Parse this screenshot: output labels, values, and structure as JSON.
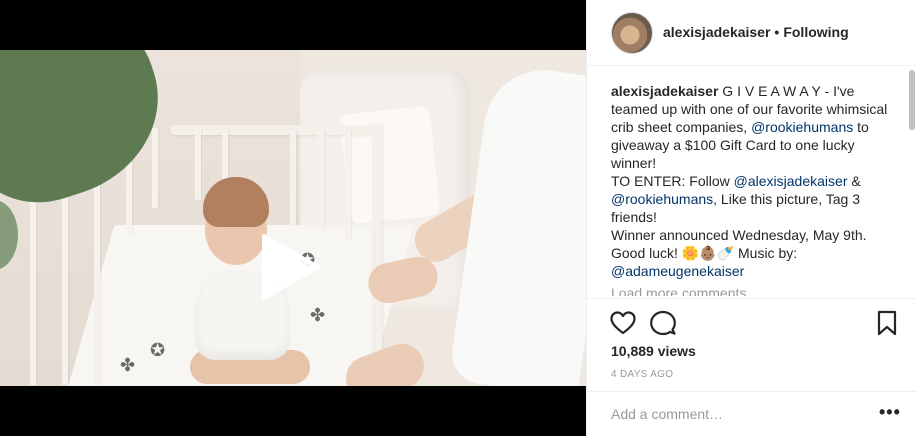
{
  "post": {
    "username": "alexisjadekaiser",
    "separator": "•",
    "follow_label": "Following"
  },
  "caption": {
    "user": "alexisjadekaiser",
    "text_1": " G I V E A W A Y - I've teamed up with one of our favorite whimsical crib sheet companies, ",
    "mention_1": "@rookiehumans",
    "text_2": " to giveaway a $100 Gift Card to one lucky winner!",
    "enter_line": "TO ENTER: Follow ",
    "mention_2": "@alexisjadekaiser",
    "text_3": " & ",
    "mention_3": "@rookiehumans",
    "text_4": ", Like this picture, Tag 3 friends!",
    "winner_line": "Winner announced Wednesday, May 9th.",
    "good_luck": "Good luck! 🌼👶🏽🍼 Music by:",
    "mention_4": "@adameugenekaiser"
  },
  "load_more": "Load more comments",
  "views": "10,889 views",
  "timestamp": "4 DAYS AGO",
  "comment_box": {
    "placeholder": "Add a comment…",
    "more_label": "•••"
  },
  "icons": {
    "like": "heart-icon",
    "comment": "comment-bubble-icon",
    "save": "bookmark-icon",
    "play": "play-icon"
  },
  "colors": {
    "link": "#003569",
    "muted": "#999999",
    "border": "#efefef"
  }
}
